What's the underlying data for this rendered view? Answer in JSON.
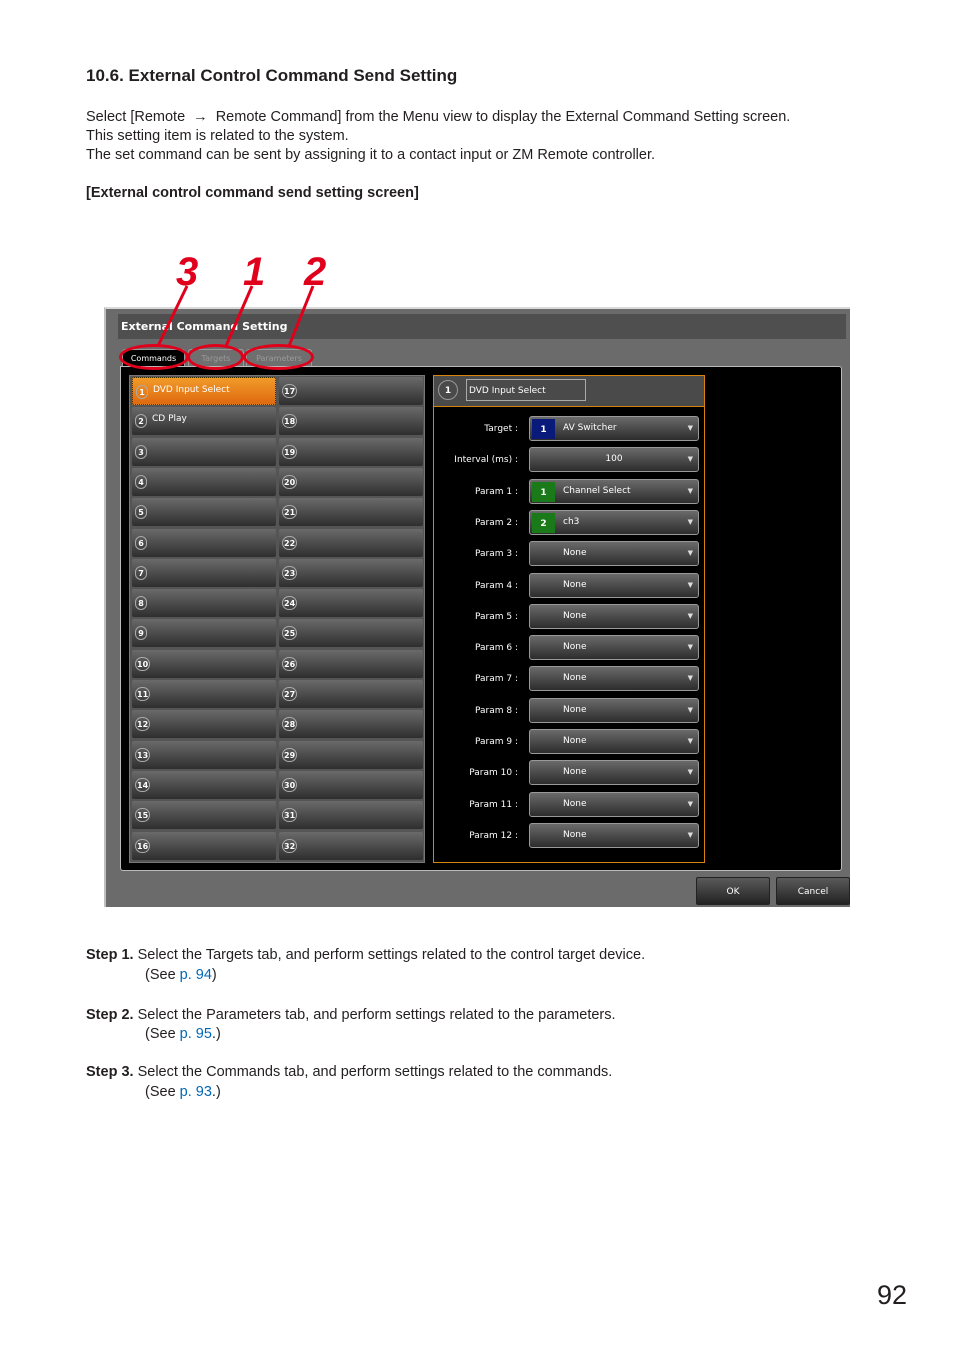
{
  "heading": "10.6. External Control Command Send Setting",
  "intro": {
    "line1_before": "Select [Remote",
    "arrow": "→",
    "line1_after": "Remote Command] from the Menu view to display the External Command Setting screen.",
    "line2": "This setting item is related to the system.",
    "line3": "The set command can be sent by assigning it to a contact input or ZM Remote controller."
  },
  "caption": "[External control command send setting screen]",
  "callouts": [
    "3",
    "1",
    "2"
  ],
  "window": {
    "title": "External Command Setting",
    "tabs": [
      {
        "label": "Commands",
        "active": true
      },
      {
        "label": "Targets",
        "active": false
      },
      {
        "label": "Parameters",
        "active": false
      }
    ],
    "commands": [
      {
        "num": "1",
        "label": "DVD Input Select",
        "selected": true
      },
      {
        "num": "2",
        "label": "CD Play"
      },
      {
        "num": "3",
        "label": ""
      },
      {
        "num": "4",
        "label": ""
      },
      {
        "num": "5",
        "label": ""
      },
      {
        "num": "6",
        "label": ""
      },
      {
        "num": "7",
        "label": ""
      },
      {
        "num": "8",
        "label": ""
      },
      {
        "num": "9",
        "label": ""
      },
      {
        "num": "10",
        "label": ""
      },
      {
        "num": "11",
        "label": ""
      },
      {
        "num": "12",
        "label": ""
      },
      {
        "num": "13",
        "label": ""
      },
      {
        "num": "14",
        "label": ""
      },
      {
        "num": "15",
        "label": ""
      },
      {
        "num": "16",
        "label": ""
      },
      {
        "num": "17",
        "label": ""
      },
      {
        "num": "18",
        "label": ""
      },
      {
        "num": "19",
        "label": ""
      },
      {
        "num": "20",
        "label": ""
      },
      {
        "num": "21",
        "label": ""
      },
      {
        "num": "22",
        "label": ""
      },
      {
        "num": "23",
        "label": ""
      },
      {
        "num": "24",
        "label": ""
      },
      {
        "num": "25",
        "label": ""
      },
      {
        "num": "26",
        "label": ""
      },
      {
        "num": "27",
        "label": ""
      },
      {
        "num": "28",
        "label": ""
      },
      {
        "num": "29",
        "label": ""
      },
      {
        "num": "30",
        "label": ""
      },
      {
        "num": "31",
        "label": ""
      },
      {
        "num": "32",
        "label": ""
      }
    ],
    "detail": {
      "num": "1",
      "name": "DVD Input Select",
      "rows": [
        {
          "label": "Target :",
          "badge": "1",
          "badge_color": "#0a1a7a",
          "value": "AV Switcher"
        },
        {
          "label": "Interval (ms) :",
          "value": "100",
          "center": true
        },
        {
          "label": "Param 1 :",
          "badge": "1",
          "badge_color": "#1a7a1a",
          "value": "Channel Select"
        },
        {
          "label": "Param 2 :",
          "badge": "2",
          "badge_color": "#1a7a1a",
          "value": "ch3"
        },
        {
          "label": "Param 3 :",
          "value": "None"
        },
        {
          "label": "Param 4 :",
          "value": "None"
        },
        {
          "label": "Param 5 :",
          "value": "None"
        },
        {
          "label": "Param 6 :",
          "value": "None"
        },
        {
          "label": "Param 7 :",
          "value": "None"
        },
        {
          "label": "Param 8 :",
          "value": "None"
        },
        {
          "label": "Param 9 :",
          "value": "None"
        },
        {
          "label": "Param 10 :",
          "value": "None"
        },
        {
          "label": "Param 11 :",
          "value": "None"
        },
        {
          "label": "Param 12 :",
          "value": "None"
        }
      ]
    },
    "ok_label": "OK",
    "cancel_label": "Cancel",
    "dropdown_caret": "▼"
  },
  "steps": [
    {
      "label": "Step 1.",
      "text": "Select the Targets tab, and perform settings related to the control target device.",
      "see_before": "(See ",
      "link": "p. 94",
      "see_after": ")"
    },
    {
      "label": "Step 2.",
      "text": "Select the Parameters tab, and perform settings related to the parameters.",
      "see_before": "(See ",
      "link": "p. 95",
      "see_after": ".)"
    },
    {
      "label": "Step 3.",
      "text": "Select the Commands tab, and perform settings related to the commands.",
      "see_before": "(See ",
      "link": "p. 93",
      "see_after": ".)"
    }
  ],
  "page_number": "92",
  "colors": {
    "accent_orange": "#e8801a",
    "callout_red": "#e0001b",
    "link_blue": "#0068b7"
  }
}
